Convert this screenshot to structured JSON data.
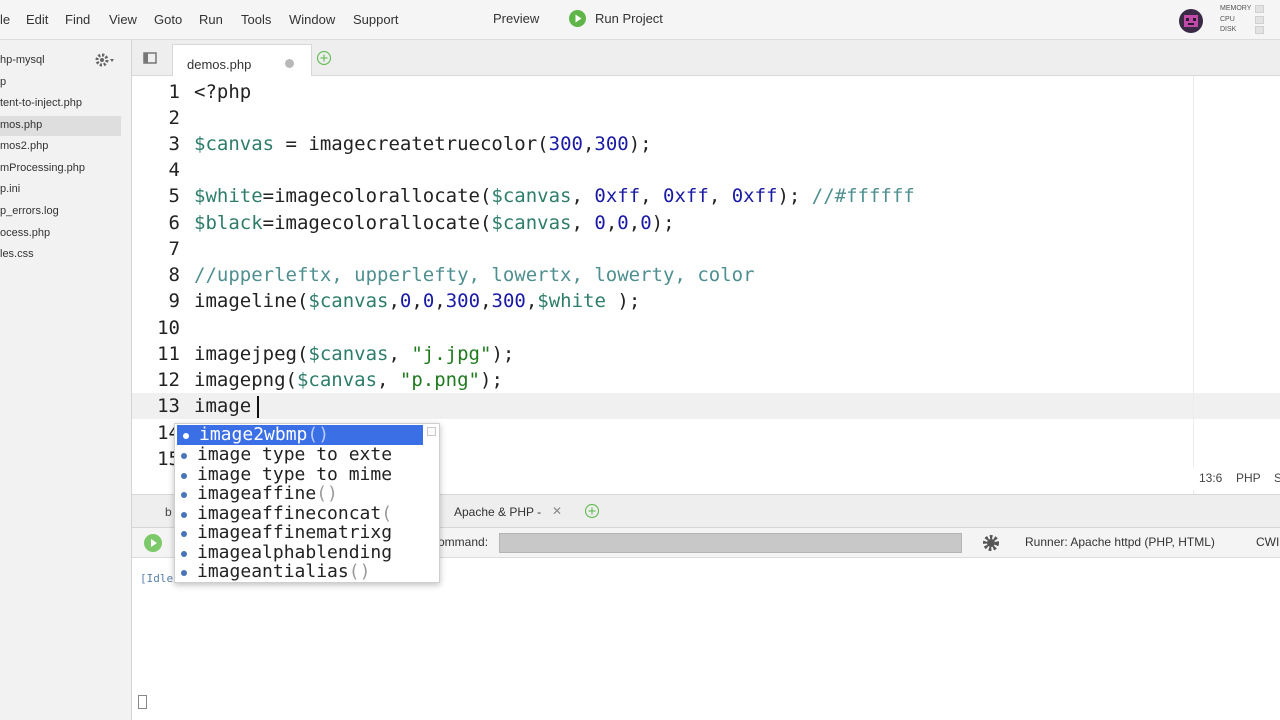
{
  "menubar": {
    "items": [
      "le",
      "Edit",
      "Find",
      "View",
      "Goto",
      "Run",
      "Tools",
      "Window",
      "Support"
    ],
    "preview_label": "Preview",
    "run_project_label": "Run Project",
    "sys_memory": "MEMORY",
    "sys_cpu": "CPU",
    "sys_disk": "DISK"
  },
  "sidebar": {
    "header": "hp-mysql",
    "files": [
      "p",
      "tent-to-inject.php",
      "mos.php",
      "mos2.php",
      "mProcessing.php",
      "p.ini",
      "p_errors.log",
      "ocess.php",
      "les.css"
    ]
  },
  "editor": {
    "tab_label": "demos.php",
    "line_numbers": [
      "1",
      "2",
      "3",
      "4",
      "5",
      "6",
      "7",
      "8",
      "9",
      "10",
      "11",
      "12",
      "13",
      "14",
      "15"
    ],
    "lines": {
      "l1": "<?php",
      "l3a": "$canvas",
      "l3b": " = imagecreatetruecolor(",
      "l3c": "300",
      "l3d": ",",
      "l3e": "300",
      "l3f": ");",
      "l5a": "$white",
      "l5b": "=imagecolorallocate(",
      "l5c": "$canvas",
      "l5d": ", ",
      "l5e": "0xff",
      "l5f": ", ",
      "l5g": "0xff",
      "l5h": ", ",
      "l5i": "0xff",
      "l5j": "); ",
      "l5k": "//#ffffff",
      "l6a": "$black",
      "l6b": "=imagecolorallocate(",
      "l6c": "$canvas",
      "l6d": ", ",
      "l6e": "0",
      "l6f": ",",
      "l6g": "0",
      "l6h": ",",
      "l6i": "0",
      "l6j": ");",
      "l8": "//upperleftx, upperlefty, lowertx, lowerty, color",
      "l9a": "imageline(",
      "l9b": "$canvas",
      "l9c": ",",
      "l9d": "0",
      "l9e": ",",
      "l9f": "0",
      "l9g": ",",
      "l9h": "300",
      "l9i": ",",
      "l9j": "300",
      "l9k": ",",
      "l9l": "$white",
      "l9m": " );",
      "l11a": "imagejpeg(",
      "l11b": "$canvas",
      "l11c": ", ",
      "l11d": "\"j.jpg\"",
      "l11e": ");",
      "l12a": "imagepng(",
      "l12b": "$canvas",
      "l12c": ", ",
      "l12d": "\"p.png\"",
      "l12e": ");",
      "l13": "image"
    }
  },
  "autocomplete": {
    "items": [
      {
        "prefix": "image",
        "rest": "2wbmp",
        "paren": "()"
      },
      {
        "prefix": "image",
        "rest": " type to exte",
        "paren": ""
      },
      {
        "prefix": "image",
        "rest": " type to mime",
        "paren": ""
      },
      {
        "prefix": "image",
        "rest": "affine",
        "paren": "()"
      },
      {
        "prefix": "image",
        "rest": "affineconcat",
        "paren": "("
      },
      {
        "prefix": "image",
        "rest": "affinematrixg",
        "paren": ""
      },
      {
        "prefix": "image",
        "rest": "alphablending",
        "paren": ""
      },
      {
        "prefix": "image",
        "rest": "antialias",
        "paren": "()"
      }
    ]
  },
  "statusbar": {
    "position": "13:6",
    "language": "PHP",
    "extra": "S"
  },
  "bottom_panel": {
    "tab_partial": "b",
    "tab_apache": "Apache & PHP -",
    "command_label": "ommand:",
    "runner_label": "Runner: Apache httpd (PHP, HTML)",
    "cwd_label": "CWI",
    "console_text": "[Idle"
  }
}
